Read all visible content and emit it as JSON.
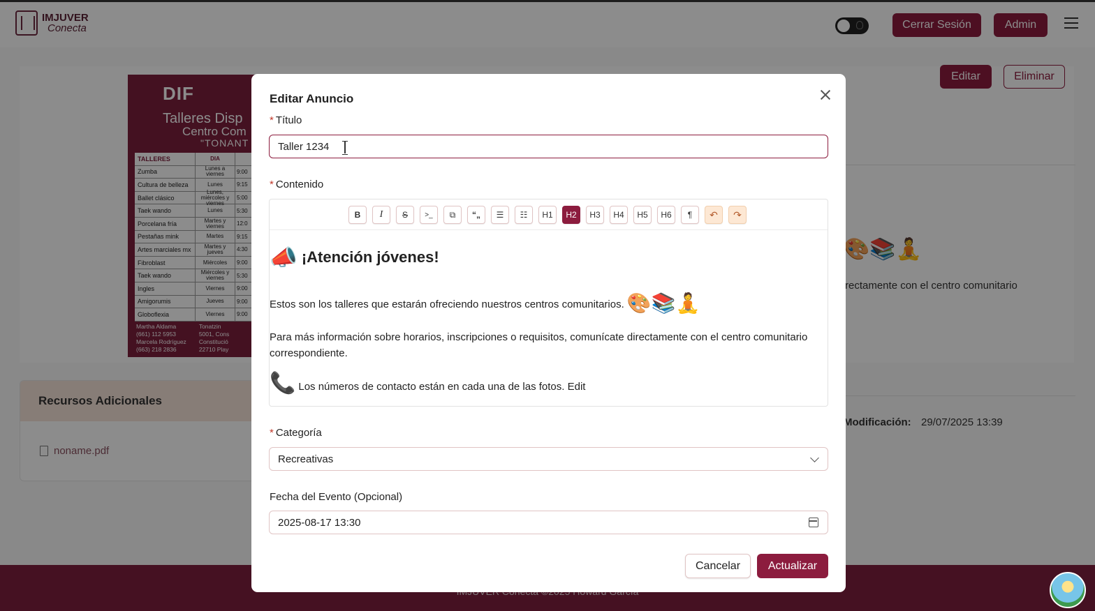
{
  "app": {
    "logo_title": "IMJUVER",
    "logo_sub": "Conecta"
  },
  "header": {
    "logout_label": "Cerrar Sesión",
    "admin_label": "Admin"
  },
  "page_actions": {
    "edit_label": "Editar",
    "delete_label": "Eliminar"
  },
  "poster": {
    "org": "DIF",
    "title_line1": "Talleres Disp",
    "title_line2": "Centro Com",
    "title_line3": "\"TONANT",
    "columns": [
      "TALLERES",
      "DIA"
    ],
    "rows": [
      {
        "taller": "Zumba",
        "dia": "Lunes a viernes",
        "hora": "9:00"
      },
      {
        "taller": "Cultura de belleza",
        "dia": "Lunes",
        "hora": "9:15"
      },
      {
        "taller": "Ballet clásico",
        "dia": "Lunes, miércoles y viernes",
        "hora": "5:00"
      },
      {
        "taller": "Taek wando",
        "dia": "Lunes",
        "hora": "5:30"
      },
      {
        "taller": "Porcelana fría",
        "dia": "Martes y viernes",
        "hora": "12:0"
      },
      {
        "taller": "Pestañas mink",
        "dia": "Martes",
        "hora": "9:15"
      },
      {
        "taller": "Artes marciales mx",
        "dia": "Martes y jueves",
        "hora": "4:30"
      },
      {
        "taller": "Fibroblast",
        "dia": "Miércoles",
        "hora": "9:00"
      },
      {
        "taller": "Taek wando",
        "dia": "Miércoles y viernes",
        "hora": "5:30"
      },
      {
        "taller": "Ingles",
        "dia": "Viernes",
        "hora": "9:00"
      },
      {
        "taller": "Amigorumis",
        "dia": "Jueves",
        "hora": "9:00"
      },
      {
        "taller": "Globoflexia",
        "dia": "Viernes",
        "hora": "9:00"
      }
    ],
    "contacts": [
      "Martha Aldama",
      "(661) 112 5953",
      "Marcela Rodríguez",
      "(663) 218 2836"
    ],
    "address": [
      "Tonatzin",
      "5001, Cons",
      "Constitució",
      "22710 Play"
    ]
  },
  "resources": {
    "title": "Recursos Adicionales",
    "file_name": "noname.pdf"
  },
  "right_panel": {
    "emojis": "🎨📚🧘",
    "text": "rectamente con el centro comunitario",
    "mod_label": "Modificación:",
    "mod_value": "29/07/2025 13:39"
  },
  "footer": {
    "text": "IMJUVER Conecta ©2025 Howard García"
  },
  "modal": {
    "title": "Editar Anuncio",
    "title_label": "Título",
    "title_value": "Taller 1234",
    "content_label": "Contenido",
    "toolbar": {
      "bold": "B",
      "italic": "I",
      "strike": "S",
      "code": ">_",
      "copy": "⧉",
      "quote": "“„",
      "bullet_list": "☰",
      "ordered_list": "☷",
      "h1": "H1",
      "h2": "H2",
      "h3": "H3",
      "h4": "H4",
      "h5": "H5",
      "h6": "H6",
      "format": "¶",
      "undo": "↶",
      "redo": "↷"
    },
    "content": {
      "heading_emoji": "📣",
      "heading": "¡Atención jóvenes!",
      "p1": "Estos son los talleres que estarán ofreciendo nuestros centros comunitarios.",
      "p1_emojis": "🎨📚🧘",
      "p2": "Para más información sobre horarios, inscripciones o requisitos, comunícate directamente con el centro comunitario correspondiente.",
      "p3_emoji": "📞",
      "p3": "Los números de contacto están en cada una de las fotos. Edit"
    },
    "category_label": "Categoría",
    "category_value": "Recreativas",
    "date_label": "Fecha del Evento (Opcional)",
    "date_value": "2025-08-17 13:30",
    "cancel_label": "Cancelar",
    "update_label": "Actualizar"
  },
  "colors": {
    "brand": "#8c1c3e",
    "footer": "#7e1f3e",
    "resources_head": "#f6e3d9"
  }
}
